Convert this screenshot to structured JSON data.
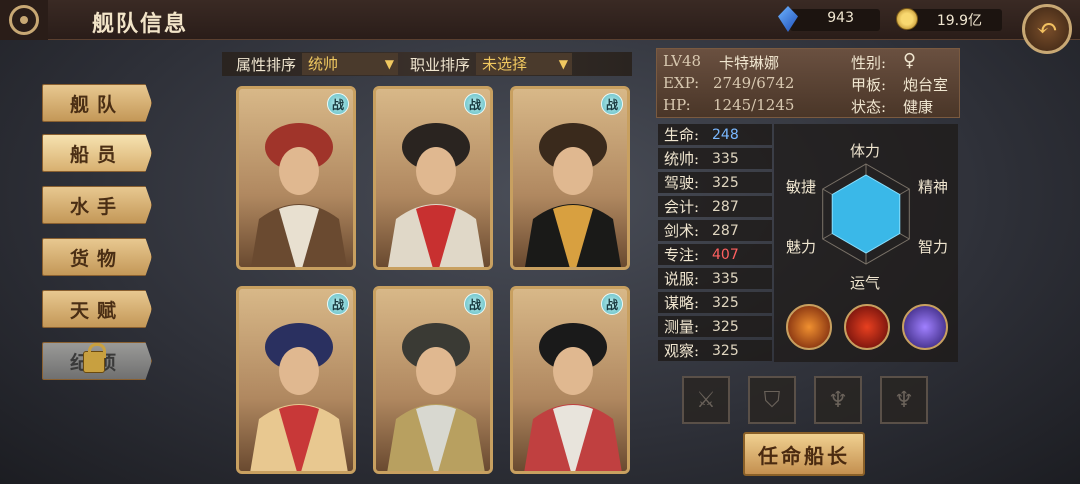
{
  "header": {
    "title": "舰队信息",
    "gems": "943",
    "gold": "19.9亿"
  },
  "nav": {
    "items": [
      {
        "label": "舰队",
        "active": false
      },
      {
        "label": "船员",
        "active": true
      },
      {
        "label": "水手",
        "active": false
      },
      {
        "label": "货物",
        "active": false
      },
      {
        "label": "天赋",
        "active": false
      },
      {
        "label": "纪项",
        "active": false,
        "locked": true
      }
    ]
  },
  "sort": {
    "attr_label": "属性排序",
    "attr_value": "统帅",
    "job_label": "职业排序",
    "job_value": "未选择",
    "arrow": "▼"
  },
  "cards": [
    {
      "name": "turban-captain",
      "badge": "战",
      "colors": [
        "#a0342a",
        "#e8e0d0",
        "#6a4a30"
      ]
    },
    {
      "name": "tricorn-pirate",
      "badge": "战",
      "colors": [
        "#2a2420",
        "#c83030",
        "#e0d8c8"
      ]
    },
    {
      "name": "eastern-official",
      "badge": "战",
      "colors": [
        "#3a2a1c",
        "#d8a040",
        "#1a1a18"
      ]
    },
    {
      "name": "plumed-admiral",
      "badge": "战",
      "colors": [
        "#2a3060",
        "#c83838",
        "#e8c890"
      ]
    },
    {
      "name": "white-haired-sailor",
      "badge": "战",
      "colors": [
        "#3a3a34",
        "#d8d8d0",
        "#b8a060"
      ]
    },
    {
      "name": "robed-scholar",
      "badge": "战",
      "colors": [
        "#1a1a1a",
        "#e8e4dc",
        "#c04040"
      ]
    }
  ],
  "info": {
    "level": "LV48",
    "name": "卡特琳娜",
    "exp_label": "EXP:",
    "exp": "2749/6742",
    "hp_label": "HP:",
    "hp": "1245/1245",
    "gender_label": "性别:",
    "gender": "♀",
    "deck_label": "甲板:",
    "deck": "炮台室",
    "status_label": "状态:",
    "status": "健康"
  },
  "stats": [
    {
      "key": "生命:",
      "value": "248",
      "color": "blue"
    },
    {
      "key": "统帅:",
      "value": "335"
    },
    {
      "key": "驾驶:",
      "value": "325"
    },
    {
      "key": "会计:",
      "value": "287"
    },
    {
      "key": "剑术:",
      "value": "287"
    },
    {
      "key": "专注:",
      "value": "407",
      "color": "red"
    },
    {
      "key": "说服:",
      "value": "335"
    },
    {
      "key": "谋略:",
      "value": "325"
    },
    {
      "key": "测量:",
      "value": "325"
    },
    {
      "key": "观察:",
      "value": "325"
    }
  ],
  "radar": {
    "labels": [
      "体力",
      "精神",
      "智力",
      "运气",
      "魅力",
      "敏捷"
    ],
    "fill_color": "#3ab8e8"
  },
  "skills": [
    "fire-slash-icon",
    "red-arrow-icon",
    "purple-mask-icon"
  ],
  "equipment": [
    "sword-icon",
    "armor-icon",
    "cup-icon",
    "goblet-icon"
  ],
  "appoint_label": "任命船长",
  "colors": {
    "accent": "#c8a060",
    "green_text": "#5ae070",
    "panel_brown": "#6a5040"
  }
}
